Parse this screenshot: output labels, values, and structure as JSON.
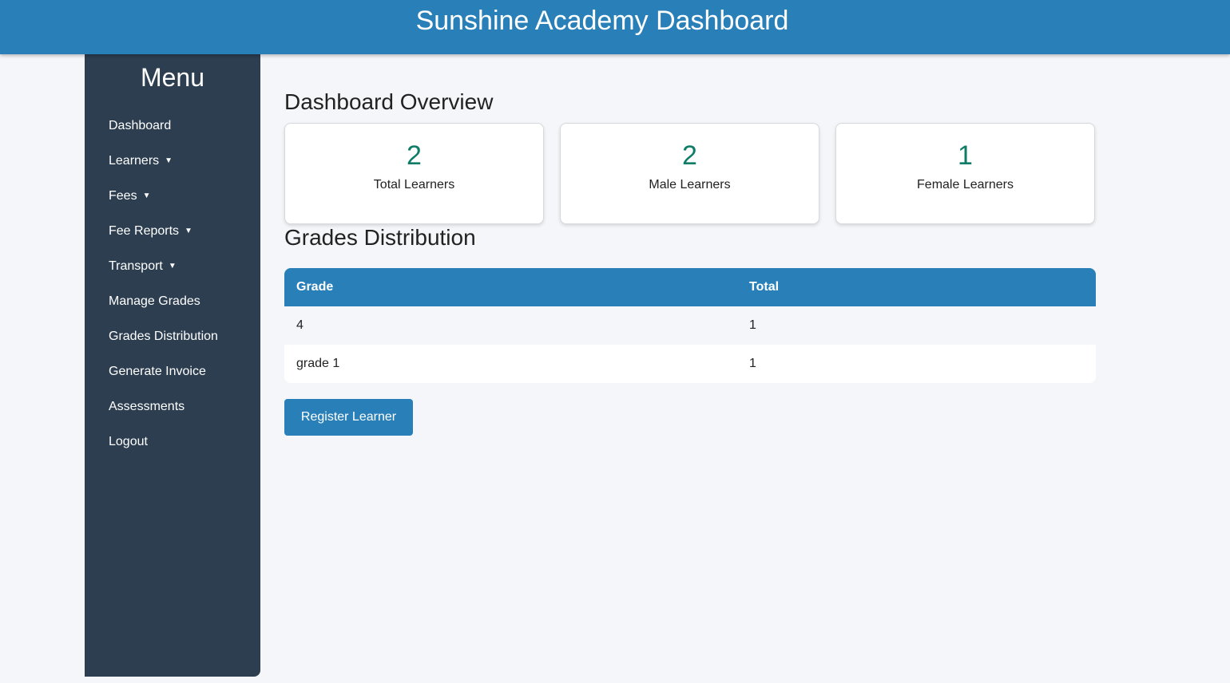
{
  "header": {
    "title": "Sunshine Academy Dashboard"
  },
  "sidebar": {
    "title": "Menu",
    "items": [
      {
        "label": "Dashboard",
        "has_dropdown": false
      },
      {
        "label": "Learners",
        "has_dropdown": true
      },
      {
        "label": "Fees",
        "has_dropdown": true
      },
      {
        "label": "Fee Reports",
        "has_dropdown": true
      },
      {
        "label": "Transport",
        "has_dropdown": true
      },
      {
        "label": "Manage Grades",
        "has_dropdown": false
      },
      {
        "label": "Grades Distribution",
        "has_dropdown": false
      },
      {
        "label": "Generate Invoice",
        "has_dropdown": false
      },
      {
        "label": "Assessments",
        "has_dropdown": false
      },
      {
        "label": "Logout",
        "has_dropdown": false
      }
    ],
    "caret": "▼"
  },
  "overview": {
    "title": "Dashboard Overview",
    "cards": [
      {
        "value": "2",
        "label": "Total Learners"
      },
      {
        "value": "2",
        "label": "Male Learners"
      },
      {
        "value": "1",
        "label": "Female Learners"
      }
    ]
  },
  "grades": {
    "title": "Grades Distribution",
    "columns": [
      "Grade",
      "Total"
    ],
    "rows": [
      [
        "4",
        "1"
      ],
      [
        "grade 1",
        "1"
      ]
    ]
  },
  "actions": {
    "register_label": "Register Learner"
  },
  "colors": {
    "header_bg": "#2980b9",
    "sidebar_bg": "#2c3e50",
    "page_bg": "#f4f6f9",
    "stat_number": "#0e7c66",
    "button_bg": "#2980b9"
  }
}
